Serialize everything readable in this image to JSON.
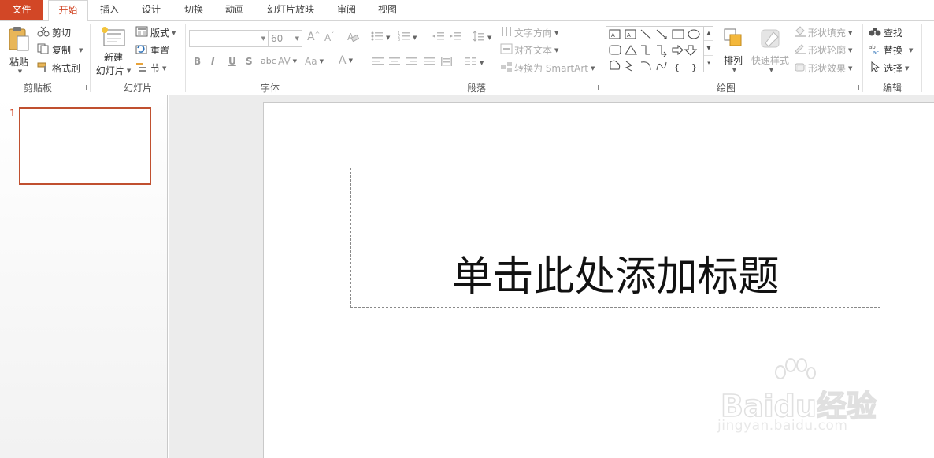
{
  "tabs": [
    {
      "label": "文件"
    },
    {
      "label": "开始"
    },
    {
      "label": "插入"
    },
    {
      "label": "设计"
    },
    {
      "label": "切换"
    },
    {
      "label": "动画"
    },
    {
      "label": "幻灯片放映"
    },
    {
      "label": "审阅"
    },
    {
      "label": "视图"
    }
  ],
  "clipboard": {
    "group_label": "剪贴板",
    "paste": "粘贴",
    "cut": "剪切",
    "copy": "复制",
    "format_painter": "格式刷"
  },
  "slides_group": {
    "group_label": "幻灯片",
    "new_slide_line1": "新建",
    "new_slide_line2": "幻灯片",
    "layout": "版式",
    "reset": "重置",
    "section": "节"
  },
  "font": {
    "group_label": "字体",
    "font_name": "",
    "font_size": "60",
    "bold": "B",
    "italic": "I",
    "underline": "U",
    "shadow": "S",
    "strikethrough": "abc",
    "spacing": "AV",
    "change_case": "Aa",
    "font_color": "A",
    "grow": "A",
    "shrink": "A"
  },
  "paragraph": {
    "group_label": "段落",
    "text_direction": "文字方向",
    "align_text": "对齐文本",
    "convert_smartart": "转换为 SmartArt"
  },
  "drawing": {
    "group_label": "绘图",
    "arrange": "排列",
    "quick_styles": "快速样式",
    "shape_fill": "形状填充",
    "shape_outline": "形状轮廓",
    "shape_effects": "形状效果"
  },
  "editing": {
    "group_label": "编辑",
    "find": "查找",
    "replace": "替换",
    "select": "选择"
  },
  "thumbnails": [
    {
      "number": "1"
    }
  ],
  "slide": {
    "title_placeholder": "单击此处添加标题"
  },
  "watermark": {
    "brand": "Baidu经验",
    "url": "jingyan.baidu.com"
  },
  "colors": {
    "accent": "#d24726",
    "thumb_border": "#c0502f"
  }
}
